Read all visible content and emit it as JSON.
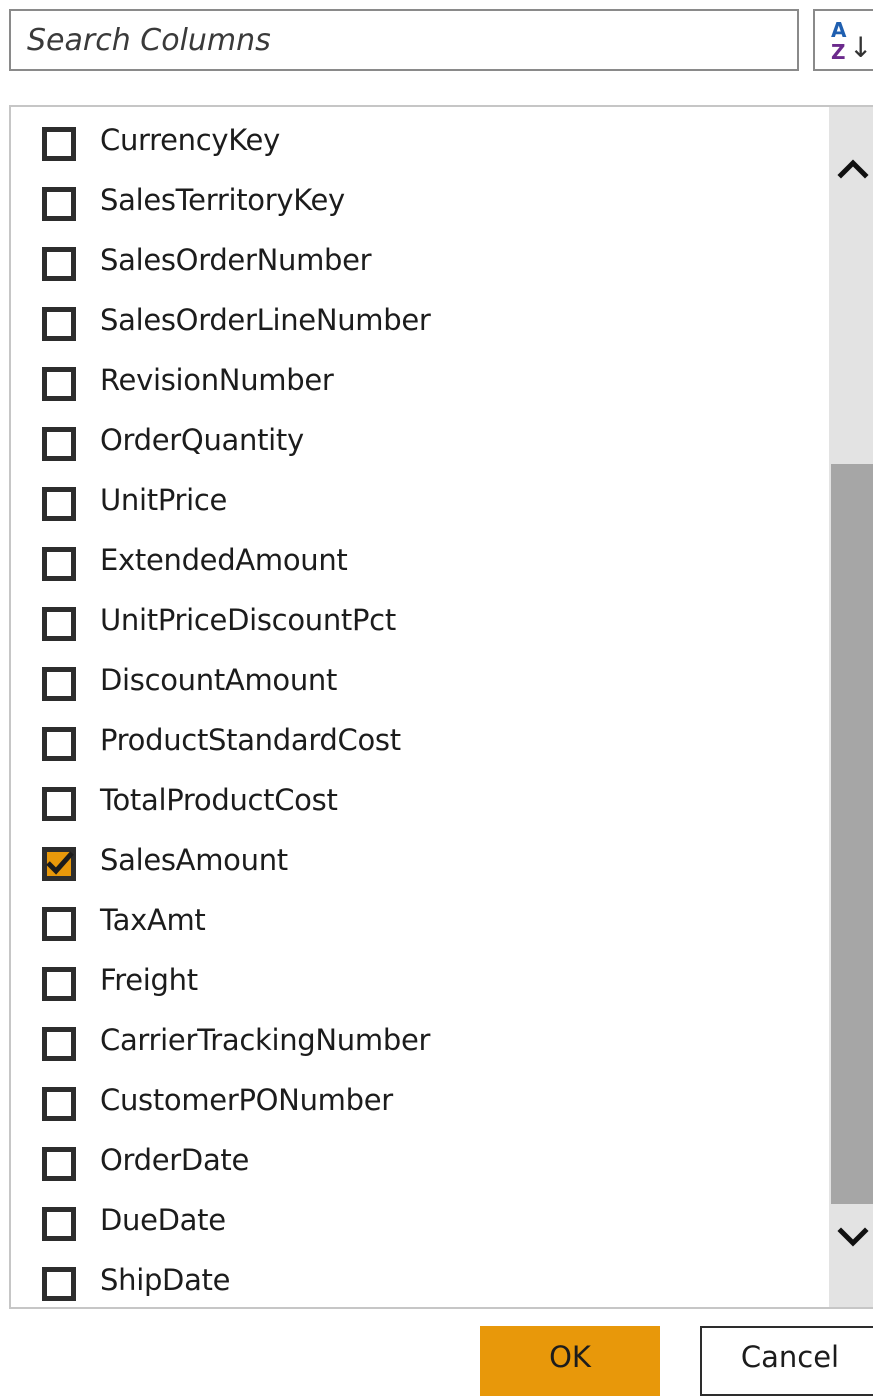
{
  "search": {
    "placeholder": "Search Columns",
    "value": ""
  },
  "sort_button": {
    "icon": "sort-az-icon",
    "glyph_top": "A",
    "glyph_bottom": "Z",
    "arrow": "↓"
  },
  "columns": [
    {
      "label": "CurrencyKey",
      "checked": false
    },
    {
      "label": "SalesTerritoryKey",
      "checked": false
    },
    {
      "label": "SalesOrderNumber",
      "checked": false
    },
    {
      "label": "SalesOrderLineNumber",
      "checked": false
    },
    {
      "label": "RevisionNumber",
      "checked": false
    },
    {
      "label": "OrderQuantity",
      "checked": false
    },
    {
      "label": "UnitPrice",
      "checked": false
    },
    {
      "label": "ExtendedAmount",
      "checked": false
    },
    {
      "label": "UnitPriceDiscountPct",
      "checked": false
    },
    {
      "label": "DiscountAmount",
      "checked": false
    },
    {
      "label": "ProductStandardCost",
      "checked": false
    },
    {
      "label": "TotalProductCost",
      "checked": false
    },
    {
      "label": "SalesAmount",
      "checked": true
    },
    {
      "label": "TaxAmt",
      "checked": false
    },
    {
      "label": "Freight",
      "checked": false
    },
    {
      "label": "CarrierTrackingNumber",
      "checked": false
    },
    {
      "label": "CustomerPONumber",
      "checked": false
    },
    {
      "label": "OrderDate",
      "checked": false
    },
    {
      "label": "DueDate",
      "checked": false
    },
    {
      "label": "ShipDate",
      "checked": false
    }
  ],
  "scrollbar": {
    "up_icon": "chevron-up-icon",
    "down_icon": "chevron-down-icon"
  },
  "buttons": {
    "ok_label": "OK",
    "cancel_label": "Cancel"
  },
  "colors": {
    "accent": "#e8980a",
    "checkbox_border": "#2d2d2d",
    "scrollbar_track": "#e3e3e3",
    "scrollbar_thumb": "#a6a6a6",
    "sort_icon_blue": "#1f5fb0",
    "sort_icon_purple": "#6b2a8c"
  }
}
